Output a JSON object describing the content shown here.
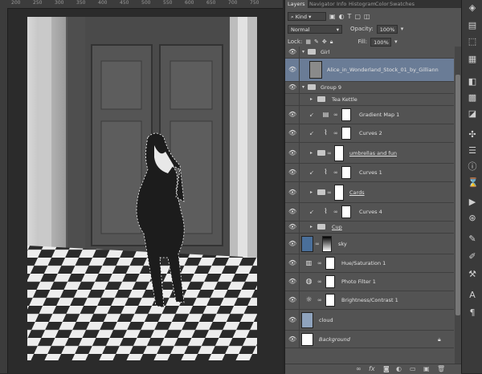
{
  "rulers": {
    "top_ticks": [
      "200",
      "250",
      "300",
      "350",
      "400",
      "450",
      "500",
      "550",
      "600",
      "650",
      "700",
      "750"
    ]
  },
  "panel": {
    "tabs": [
      "Layers",
      "Navigator",
      "Info",
      "Histogram",
      "Color",
      "Swatches"
    ],
    "kind_label": "Kind",
    "blend_mode": "Normal",
    "opacity_label": "Opacity:",
    "opacity_value": "100%",
    "lock_label": "Lock:",
    "fill_label": "Fill:",
    "fill_value": "100%"
  },
  "layers": [
    {
      "name": "Girl",
      "type": "group",
      "expanded": true
    },
    {
      "name": "Alice_in_Wonderland_Stock_01_by_Gilliann",
      "type": "image",
      "selected": true
    },
    {
      "name": "Group 9",
      "type": "group",
      "expanded": true
    },
    {
      "name": "Tea Kettle",
      "type": "group",
      "expanded": false
    },
    {
      "name": "Gradient Map 1",
      "type": "adjustment",
      "icon": "gradient-icon"
    },
    {
      "name": "Curves 2",
      "type": "adjustment",
      "icon": "curves-icon"
    },
    {
      "name": "umbrellas and fun",
      "type": "group-mask"
    },
    {
      "name": "Curves 1",
      "type": "adjustment",
      "icon": "curves-icon"
    },
    {
      "name": "Cards",
      "type": "group-mask"
    },
    {
      "name": "Curves 4",
      "type": "adjustment",
      "icon": "curves-icon"
    },
    {
      "name": "Cup",
      "type": "group",
      "expanded": false
    },
    {
      "name": "sky",
      "type": "image"
    },
    {
      "name": "Hue/Saturation 1",
      "type": "adjustment",
      "icon": "hue-icon"
    },
    {
      "name": "Photo Filter 1",
      "type": "adjustment",
      "icon": "filter-icon"
    },
    {
      "name": "Brightness/Contrast 1",
      "type": "adjustment",
      "icon": "brightness-icon"
    },
    {
      "name": "cloud",
      "type": "image"
    },
    {
      "name": "Background",
      "type": "background"
    }
  ],
  "colors": {
    "panel_bg": "#535353",
    "selected_row": "#6a7c96",
    "canvas_bg": "#282828"
  }
}
